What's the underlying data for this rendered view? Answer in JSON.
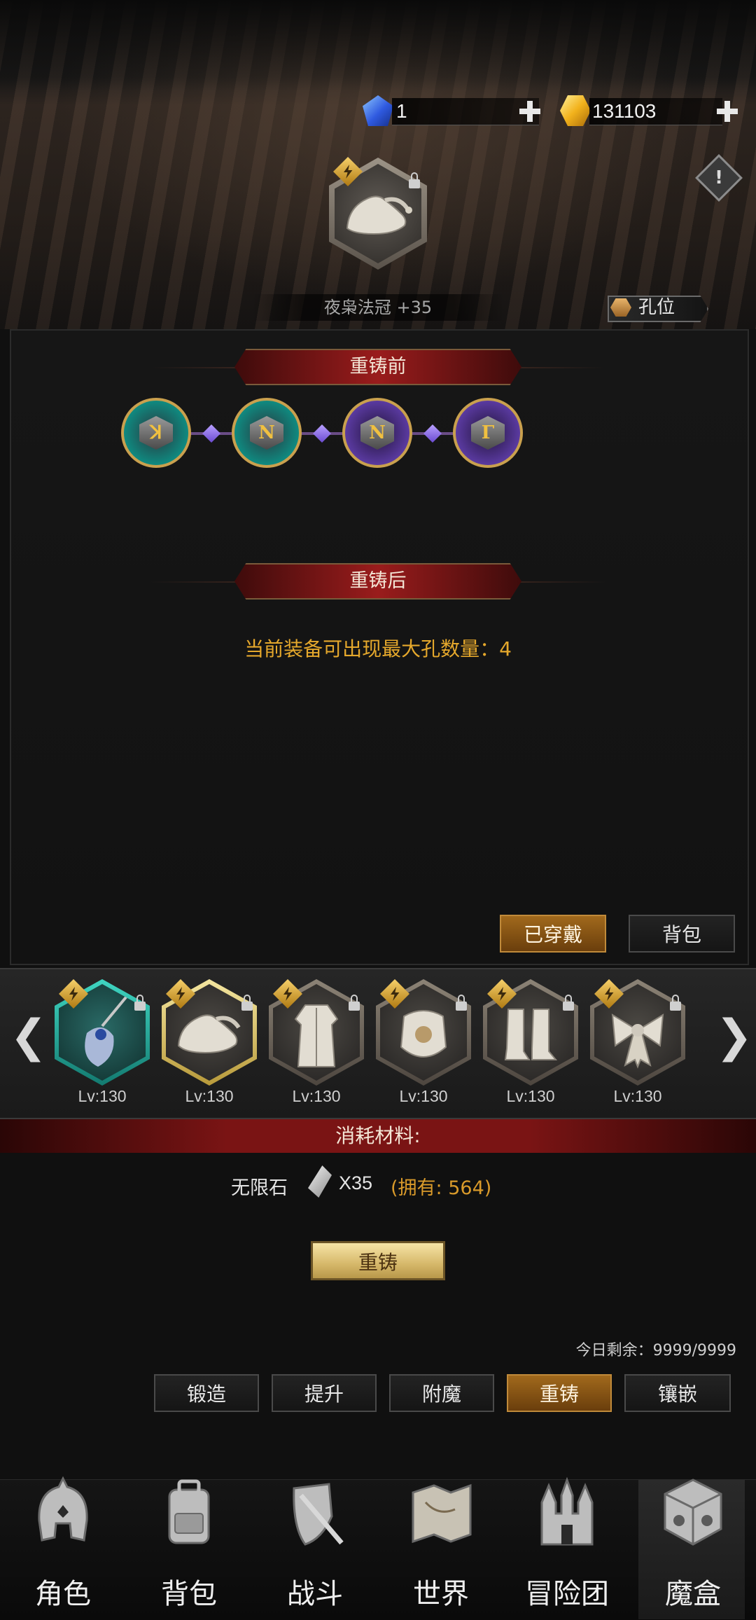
{
  "currency": {
    "diamond_value": "1",
    "gold_value": "131103"
  },
  "item": {
    "name": "夜枭法冠 +35"
  },
  "socket_button_label": "孔位",
  "sections": {
    "before_label": "重铸前",
    "after_label": "重铸后",
    "max_socket_text": "当前装备可出现最大孔数量：4"
  },
  "runes": [
    {
      "color": "teal",
      "glyph": "ꓘ"
    },
    {
      "color": "teal",
      "glyph": "N"
    },
    {
      "color": "purple",
      "glyph": "N"
    },
    {
      "color": "purple",
      "glyph": "Γ"
    }
  ],
  "filter_buttons": {
    "equipped_label": "已穿戴",
    "bag_label": "背包"
  },
  "equipment_slots": [
    {
      "icon": "staff-icon",
      "level": "Lv:130"
    },
    {
      "icon": "wizard-hat-icon",
      "level": "Lv:130"
    },
    {
      "icon": "robe-icon",
      "level": "Lv:130"
    },
    {
      "icon": "armor-icon",
      "level": "Lv:130"
    },
    {
      "icon": "boots-icon",
      "level": "Lv:130"
    },
    {
      "icon": "ribbon-icon",
      "level": "Lv:130"
    }
  ],
  "cost": {
    "title": "消耗材料:",
    "material_name": "无限石",
    "quantity": "X35",
    "owned": "(拥有: 564)"
  },
  "reforge_button_label": "重铸",
  "daily_remaining": "今日剩余：9999/9999",
  "function_tabs": [
    "锻造",
    "提升",
    "附魔",
    "重铸",
    "镶嵌"
  ],
  "active_function_tab": "重铸",
  "bottom_nav": [
    {
      "label": "角色",
      "icon": "helmet-icon"
    },
    {
      "label": "背包",
      "icon": "backpack-icon"
    },
    {
      "label": "战斗",
      "icon": "sword-shield-icon"
    },
    {
      "label": "世界",
      "icon": "map-icon"
    },
    {
      "label": "冒险团",
      "icon": "castle-icon"
    },
    {
      "label": "魔盒",
      "icon": "magic-box-icon"
    }
  ],
  "colors": {
    "accent_gold": "#e5a82c",
    "banner_red": "#9a1c1c",
    "active_tab": "#a1691c"
  }
}
